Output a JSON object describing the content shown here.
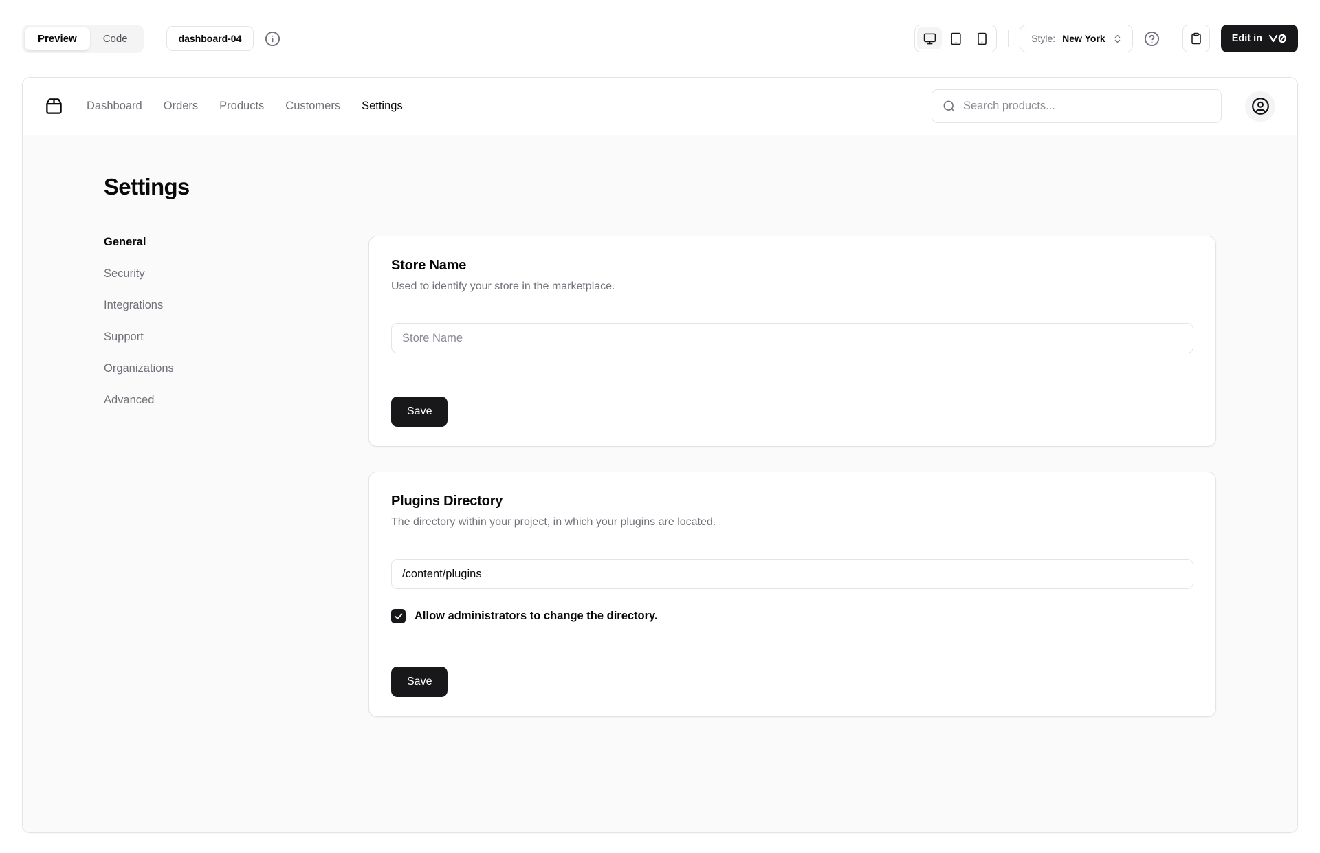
{
  "toolbar": {
    "tabs": {
      "preview": "Preview",
      "code": "Code"
    },
    "block_badge": "dashboard-04",
    "style_label": "Style:",
    "style_value": "New York",
    "edit_button_label": "Edit in",
    "icons": {
      "info": "circle-info-icon",
      "devices": [
        "monitor-icon",
        "tablet-icon",
        "smartphone-icon"
      ],
      "style_chevrons": "chevrons-up-down-icon",
      "help": "circle-question-icon",
      "copy": "clipboard-icon",
      "v0": "v0-logo"
    }
  },
  "nav": {
    "logo_icon": "package-icon",
    "links": [
      {
        "label": "Dashboard",
        "active": false
      },
      {
        "label": "Orders",
        "active": false
      },
      {
        "label": "Products",
        "active": false
      },
      {
        "label": "Customers",
        "active": false
      },
      {
        "label": "Settings",
        "active": true
      }
    ],
    "search": {
      "placeholder": "Search products...",
      "icon": "search-icon"
    },
    "avatar_icon": "circle-user-icon"
  },
  "page": {
    "title": "Settings",
    "sidebar": [
      {
        "label": "General",
        "active": true
      },
      {
        "label": "Security",
        "active": false
      },
      {
        "label": "Integrations",
        "active": false
      },
      {
        "label": "Support",
        "active": false
      },
      {
        "label": "Organizations",
        "active": false
      },
      {
        "label": "Advanced",
        "active": false
      }
    ],
    "cards": [
      {
        "title": "Store Name",
        "description": "Used to identify your store in the marketplace.",
        "input_placeholder": "Store Name",
        "input_value": "",
        "save_label": "Save"
      },
      {
        "title": "Plugins Directory",
        "description": "The directory within your project, in which your plugins are located.",
        "input_value": "/content/plugins",
        "checkbox_label": "Allow administrators to change the directory.",
        "checkbox_checked": true,
        "save_label": "Save"
      }
    ]
  },
  "colors": {
    "primary": "#18181b",
    "border": "#e4e4e7",
    "muted_text": "#71717a",
    "content_bg": "#fafafa",
    "segment_bg": "#f4f4f5"
  }
}
